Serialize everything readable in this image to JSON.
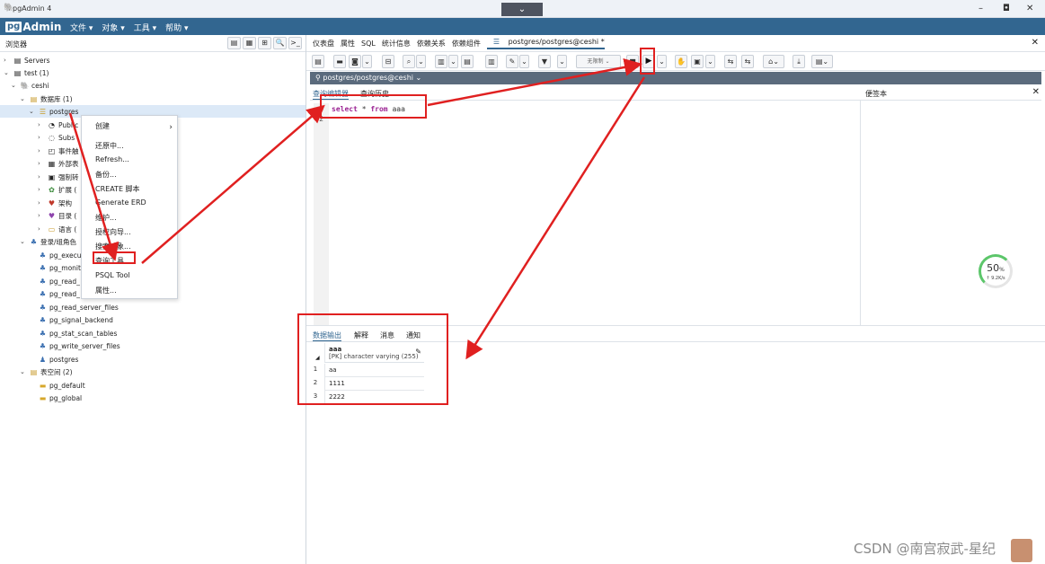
{
  "window": {
    "title": "pgAdmin 4",
    "center_chevron": "⌄",
    "minimize": "–",
    "restore": "◘",
    "close": "✕"
  },
  "menubar": {
    "brand_pg": "pg",
    "brand_text": "Admin",
    "items": [
      "文件 ▾",
      "对象 ▾",
      "工具 ▾",
      "帮助 ▾"
    ]
  },
  "browser": {
    "title": "浏览器",
    "tools": [
      "▤",
      "▦",
      "⊞",
      "🔍",
      ">_"
    ],
    "tree": [
      {
        "label": "Servers"
      },
      {
        "label": "test (1)"
      },
      {
        "label": "ceshi"
      },
      {
        "label": "数据库 (1)"
      },
      {
        "label": "postgres"
      },
      {
        "label": "Public"
      },
      {
        "label": "Subs"
      },
      {
        "label": "事件触"
      },
      {
        "label": "外部表"
      },
      {
        "label": "强制转"
      },
      {
        "label": "扩展 ("
      },
      {
        "label": "架构"
      },
      {
        "label": "目录 ("
      },
      {
        "label": "语言 ("
      },
      {
        "label": "登录/组角色"
      },
      {
        "label": "pg_execu"
      },
      {
        "label": "pg_monit"
      },
      {
        "label": "pg_read_"
      },
      {
        "label": "pg_read_"
      },
      {
        "label": "pg_read_server_files"
      },
      {
        "label": "pg_signal_backend"
      },
      {
        "label": "pg_stat_scan_tables"
      },
      {
        "label": "pg_write_server_files"
      },
      {
        "label": "postgres"
      },
      {
        "label": "表空间 (2)"
      },
      {
        "label": "pg_default"
      },
      {
        "label": "pg_global"
      }
    ]
  },
  "context_menu": {
    "items": [
      "创建",
      "还原中...",
      "Refresh...",
      "备份...",
      "CREATE 脚本",
      "Generate ERD",
      "维护...",
      "授权向导...",
      "搜索对象...",
      "查询工具",
      "PSQL Tool",
      "属性..."
    ],
    "submenu_arrow": "›"
  },
  "tabs": {
    "items": [
      "仪表盘",
      "属性",
      "SQL",
      "统计信息",
      "依赖关系",
      "依赖组件"
    ],
    "active": "postgres/postgres@ceshi *",
    "close": "✕"
  },
  "toolbar": {
    "limit_label": "无限制"
  },
  "connection": {
    "label": "postgres/postgres@ceshi ⌄"
  },
  "editor": {
    "tab_query": "查询编辑器",
    "tab_history": "查询历史",
    "scratch_pad": "便签本",
    "close": "✕",
    "line_numbers": [
      "1",
      "2"
    ],
    "kw_select": "select",
    "star": " * ",
    "kw_from": "from",
    "table": " aaa"
  },
  "progress": {
    "percent": "50",
    "unit": "%",
    "speed": "↑ 9.2K/s",
    "value": 0.5
  },
  "output": {
    "tabs": [
      "数据输出",
      "解释",
      "消息",
      "通知"
    ],
    "column_name": "aaa",
    "column_type": "[PK] character varying (255)",
    "rows": [
      {
        "n": "1",
        "value": "aa"
      },
      {
        "n": "2",
        "value": "1111"
      },
      {
        "n": "3",
        "value": "2222"
      }
    ]
  },
  "watermark": "CSDN @南宫寂武-星纪"
}
